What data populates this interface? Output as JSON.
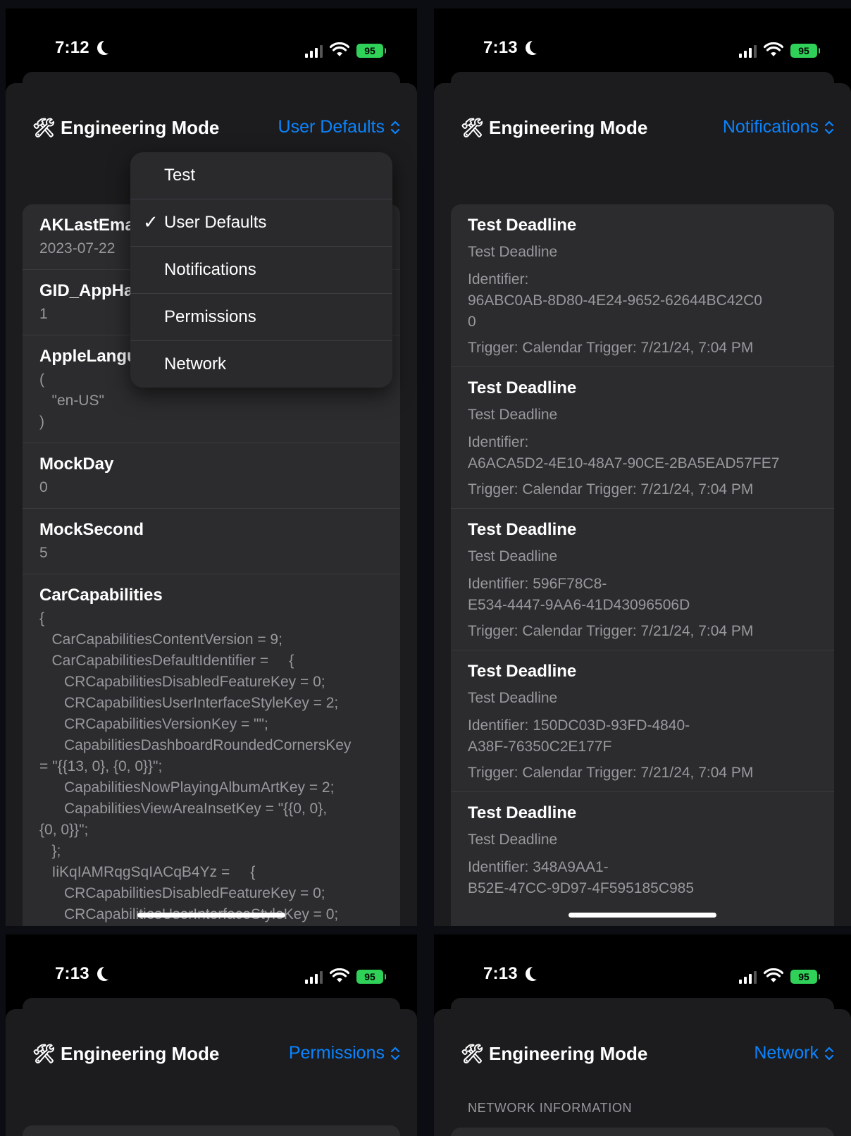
{
  "panels": {
    "p1": {
      "time": "7:12",
      "battery": "95",
      "title": "Engineering Mode",
      "picker": "User Defaults",
      "rows": [
        {
          "key": "AKLastEma",
          "value": "2023-07-22"
        },
        {
          "key": "GID_AppHa",
          "value": "1"
        },
        {
          "key": "AppleLangu",
          "value": "(\n   \"en-US\"\n)"
        },
        {
          "key": "MockDay",
          "value": "0"
        },
        {
          "key": "MockSecond",
          "value": "5"
        },
        {
          "key": "CarCapabilities",
          "value": "{\n   CarCapabilitiesContentVersion = 9;\n   CarCapabilitiesDefaultIdentifier =     {\n      CRCapabilitiesDisabledFeatureKey = 0;\n      CRCapabilitiesUserInterfaceStyleKey = 2;\n      CRCapabilitiesVersionKey = \"\";\n      CapabilitiesDashboardRoundedCornersKey\n= \"{{13, 0}, {0, 0}}\";\n      CapabilitiesNowPlayingAlbumArtKey = 2;\n      CapabilitiesViewAreaInsetKey = \"{{0, 0},\n{0, 0}}\";\n   };\n   IiKqIAMRqgSqIACqB4Yz =     {\n      CRCapabilitiesDisabledFeatureKey = 0;\n      CRCapabilitiesUserInterfaceStyleKey = 0;"
        }
      ],
      "menu": [
        {
          "label": "Test",
          "checked": false
        },
        {
          "label": "User Defaults",
          "checked": true
        },
        {
          "label": "Notifications",
          "checked": false
        },
        {
          "label": "Permissions",
          "checked": false
        },
        {
          "label": "Network",
          "checked": false
        }
      ],
      "check_glyph": "✓"
    },
    "p2": {
      "time": "7:13",
      "battery": "95",
      "title": "Engineering Mode",
      "picker": "Notifications",
      "notifications": [
        {
          "title": "Test Deadline",
          "subtitle": "Test Deadline",
          "identifier": "Identifier:\n96ABC0AB-8D80-4E24-9652-62644BC42C0\n0",
          "trigger": "Trigger: Calendar Trigger: 7/21/24, 7:04 PM"
        },
        {
          "title": "Test Deadline",
          "subtitle": "Test Deadline",
          "identifier": "Identifier:\nA6ACA5D2-4E10-48A7-90CE-2BA5EAD57FE7",
          "trigger": "Trigger: Calendar Trigger: 7/21/24, 7:04 PM"
        },
        {
          "title": "Test Deadline",
          "subtitle": "Test Deadline",
          "identifier": "Identifier: 596F78C8-\nE534-4447-9AA6-41D43096506D",
          "trigger": "Trigger: Calendar Trigger: 7/21/24, 7:04 PM"
        },
        {
          "title": "Test Deadline",
          "subtitle": "Test Deadline",
          "identifier": "Identifier: 150DC03D-93FD-4840-\nA38F-76350C2E177F",
          "trigger": "Trigger: Calendar Trigger: 7/21/24, 7:04 PM"
        },
        {
          "title": "Test Deadline",
          "subtitle": "Test Deadline",
          "identifier": "Identifier: 348A9AA1-\nB52E-47CC-9D97-4F595185C985",
          "trigger": ""
        }
      ]
    },
    "p3": {
      "time": "7:13",
      "battery": "95",
      "title": "Engineering Mode",
      "picker": "Permissions"
    },
    "p4": {
      "time": "7:13",
      "battery": "95",
      "title": "Engineering Mode",
      "picker": "Network",
      "section_header": "NETWORK INFORMATION"
    }
  },
  "icons": {
    "tools": "🛠",
    "moon": "moon-icon",
    "wifi": "wifi-icon",
    "signal": "cellular-signal-icon",
    "battery": "battery-charging-icon",
    "picker": "chevron-up-down-icon"
  },
  "colors": {
    "accent": "#0a84ff",
    "battery": "#30d158",
    "sheet": "#1c1c1e",
    "card": "#2c2c2e"
  }
}
